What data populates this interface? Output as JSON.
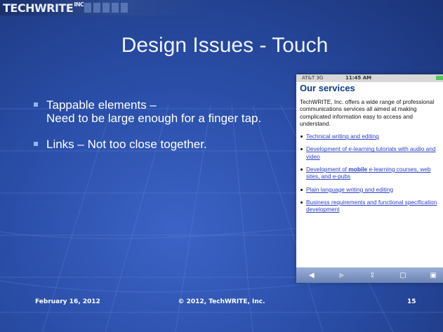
{
  "brand": {
    "logo_text": "TECHWRITE",
    "logo_suffix": "INC"
  },
  "slide": {
    "title": "Design Issues - Touch",
    "bullets": [
      {
        "label": "Tappable elements –",
        "detail": "Need to be large enough for a finger tap."
      },
      {
        "label": "Links – Not too close together.",
        "detail": ""
      }
    ]
  },
  "phone": {
    "status": {
      "carrier": "AT&T 3G",
      "time": "11:45 AM"
    },
    "heading": "Our services",
    "intro": "TechWRITE, Inc. offers a wide range of professional communications services all aimed at making complicated information easy to access and understand.",
    "links": [
      {
        "text": "Technical writing and editing"
      },
      {
        "text": "Development of e-learning tutorials with audio and video"
      },
      {
        "pre": "Development of ",
        "bold": "mobile",
        "post": " e-learning courses, web sites, and e-pubs"
      },
      {
        "text": "Plain language writing and editing"
      },
      {
        "text": "Business requirements and functional specification development"
      }
    ],
    "toolbar": [
      "back-arrow-icon",
      "forward-arrow-icon",
      "share-icon",
      "bookmarks-icon",
      "pages-icon"
    ]
  },
  "footer": {
    "date": "February 16, 2012",
    "copyright": "© 2012, TechWRITE, Inc.",
    "page_number": "15"
  },
  "colors": {
    "background": "#2a4ea8",
    "title": "#eef3ff",
    "link": "#2b3fc4",
    "heading": "#0d3a8e"
  }
}
